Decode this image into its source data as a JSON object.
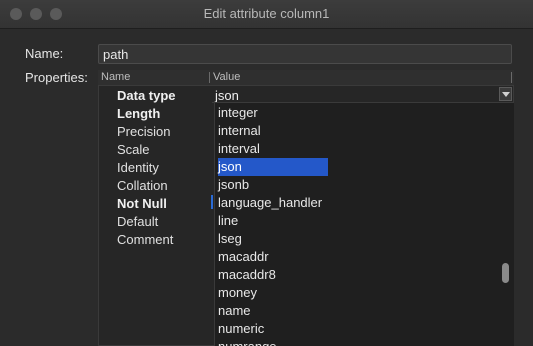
{
  "window": {
    "title": "Edit attribute column1"
  },
  "form": {
    "name_label": "Name:",
    "name_value": "path",
    "properties_label": "Properties:"
  },
  "table": {
    "headers": [
      "Name",
      "Value"
    ],
    "rows": [
      {
        "label": "Data type",
        "bold": true
      },
      {
        "label": "Length",
        "bold": true
      },
      {
        "label": "Precision",
        "bold": false
      },
      {
        "label": "Scale",
        "bold": false
      },
      {
        "label": "Identity",
        "bold": false
      },
      {
        "label": "Collation",
        "bold": false
      },
      {
        "label": "Not Null",
        "bold": true
      },
      {
        "label": "Default",
        "bold": false
      },
      {
        "label": "Comment",
        "bold": false
      }
    ]
  },
  "combo": {
    "selected": "json"
  },
  "dropdown": {
    "options": [
      "integer",
      "internal",
      "interval",
      "json",
      "jsonb",
      "language_handler",
      "line",
      "lseg",
      "macaddr",
      "macaddr8",
      "money",
      "name",
      "numeric",
      "numrange"
    ],
    "selected_index": 3
  }
}
